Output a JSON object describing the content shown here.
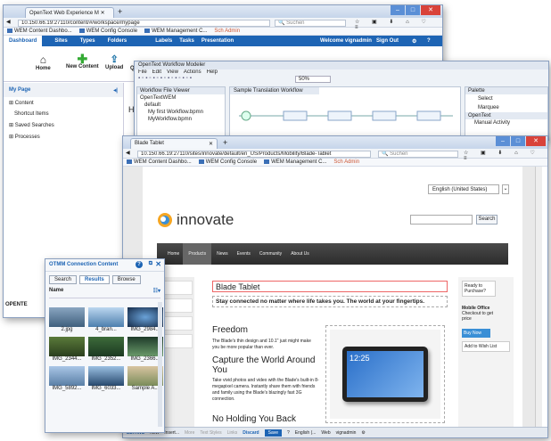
{
  "w1": {
    "tab": "OpenText Web Experience M",
    "url": "10.150.66.19:27110/content/#/workspace/mypage",
    "search": "Suchen",
    "bookmarks": [
      "WEM Content Dashbo...",
      "WEM Config Console",
      "WEM Management C...",
      "Sch Admin"
    ],
    "nav": [
      "Dashboard",
      "Sites",
      "Types",
      "Folders",
      "Labels",
      "Tasks",
      "Presentation"
    ],
    "welcome": "Welcome vignadmin",
    "signout": "Sign Out",
    "tools": [
      "Home",
      "New Content",
      "Upload",
      "Que"
    ],
    "page_title": "My Page",
    "page_title2": "Hom",
    "tree": [
      "Content",
      "Shortcut Items",
      "Saved Searches",
      "Processes"
    ],
    "footer": "OPENTE"
  },
  "w2": {
    "title": "OpenText Workflow Modeler",
    "menu": [
      "File",
      "Edit",
      "View",
      "Actions",
      "Help"
    ],
    "zoom": "50%",
    "viewer": "Workflow File Viewer",
    "tab": "Sample Translation Workflow",
    "tree": [
      "OpenTextWEM",
      "default",
      "My first Workflow.bpmn",
      "MyWorkflow.bpmn"
    ],
    "palette": "Palette",
    "pitems": [
      "Select",
      "Marquee"
    ],
    "group": "OpenText",
    "gitem": "Manual Activity"
  },
  "w3": {
    "tab": "Blade Tablet",
    "url": "10.150.66.19:27110/sites/innovate/default/en_US/Products/Mobility/Blade-Tablet",
    "search": "Suchen",
    "bookmarks": [
      "WEM Content Dashbo...",
      "WEM Config Console",
      "WEM Management C...",
      "Sch Admin"
    ],
    "lang": "English (United States)",
    "logo": "innovate",
    "sbtn": "Search",
    "nav": [
      "Home",
      "Products",
      "News",
      "Events",
      "Community",
      "About Us"
    ],
    "h1": "Blade Tablet",
    "lead": "Stay connected no matter where life takes you. The world at your fingertips.",
    "h_free": "Freedom",
    "p_free": "The Blade's thin design and 10.1\" just might make you be more popular than ever.",
    "h_cap": "Capture the World Around You",
    "p_cap": "Take vivid photos and video with the Blade's built-in 8-megapixel camera. Instantly share them with friends and family using the Blade's blazingly fast 3G connection.",
    "h_hold": "No Holding You Back",
    "clock": "12:25",
    "ready": "Ready to Purchase?",
    "mo_t": "Mobile Office",
    "mo_p": "Checkout to get price",
    "buy": "Buy Now",
    "wish": "Add to Wish List",
    "bar": {
      "editing": "EDITING",
      "new": "New",
      "insert": "Insert...",
      "more": "More",
      "styles": "Text Styles",
      "links": "Links",
      "discard": "Discard",
      "save": "Save",
      "lang": "English (...",
      "web": "Web",
      "user": "vignadmin"
    }
  },
  "panel": {
    "title": "OTMM Connection Content",
    "tabs": [
      "Search",
      "Results",
      "Browse"
    ],
    "col": "Name",
    "items": [
      "2.jpg",
      "4_bran...",
      "IMG_2984...",
      "IMG_2344...",
      "IMG_2352...",
      "IMG_2366...",
      "IMG_5892...",
      "IMG_6033...",
      "Sample A..."
    ]
  }
}
